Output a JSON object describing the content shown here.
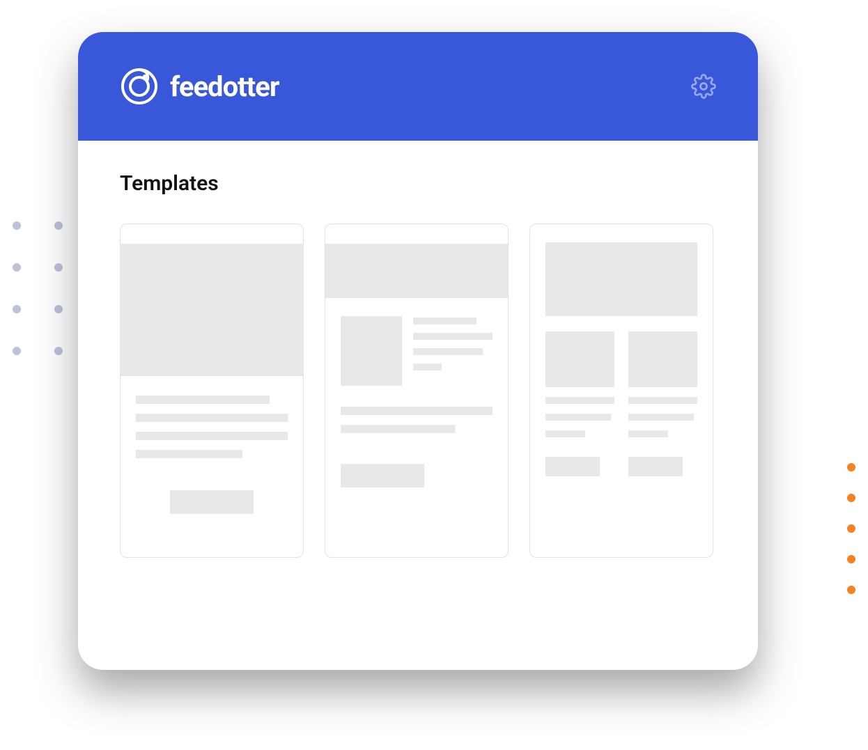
{
  "brand": {
    "name": "feedotter"
  },
  "page": {
    "title": "Templates"
  },
  "colors": {
    "primary": "#3857d9",
    "accent": "#f58220",
    "dot_muted": "#bcc2da"
  }
}
